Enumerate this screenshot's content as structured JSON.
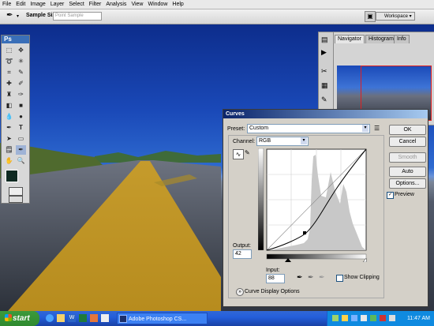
{
  "menu": [
    "File",
    "Edit",
    "Image",
    "Layer",
    "Select",
    "Filter",
    "Analysis",
    "View",
    "Window",
    "Help"
  ],
  "options_bar": {
    "sample_size_label": "Sample Size:",
    "sample_size_value": "Point Sample",
    "workspace_label": "Workspace"
  },
  "tools_panel": {
    "title": "Ps"
  },
  "navigator_panel": {
    "tabs": [
      "Navigator",
      "Histogram",
      "Info"
    ]
  },
  "dialog": {
    "title": "Curves",
    "preset_label": "Preset:",
    "preset_value": "Custom",
    "channel_label": "Channel:",
    "channel_value": "RGB",
    "buttons": {
      "ok": "OK",
      "cancel": "Cancel",
      "smooth": "Smooth",
      "auto": "Auto",
      "options": "Options..."
    },
    "preview_label": "Preview",
    "preview_checked": true,
    "output_label": "Output:",
    "output_value": "42",
    "input_label": "Input:",
    "input_value": "88",
    "show_clipping_label": "Show Clipping",
    "show_clipping_checked": false,
    "curve_display_options_label": "Curve Display Options"
  },
  "taskbar": {
    "start_label": "start",
    "task_label": "Adobe Photoshop CS...",
    "clock": "11:47 AM"
  },
  "colors": {
    "titlebar_start": "#0a246a",
    "titlebar_end": "#a6caf0",
    "road_line": "#c9a12a",
    "sky": "#1a49b8"
  }
}
